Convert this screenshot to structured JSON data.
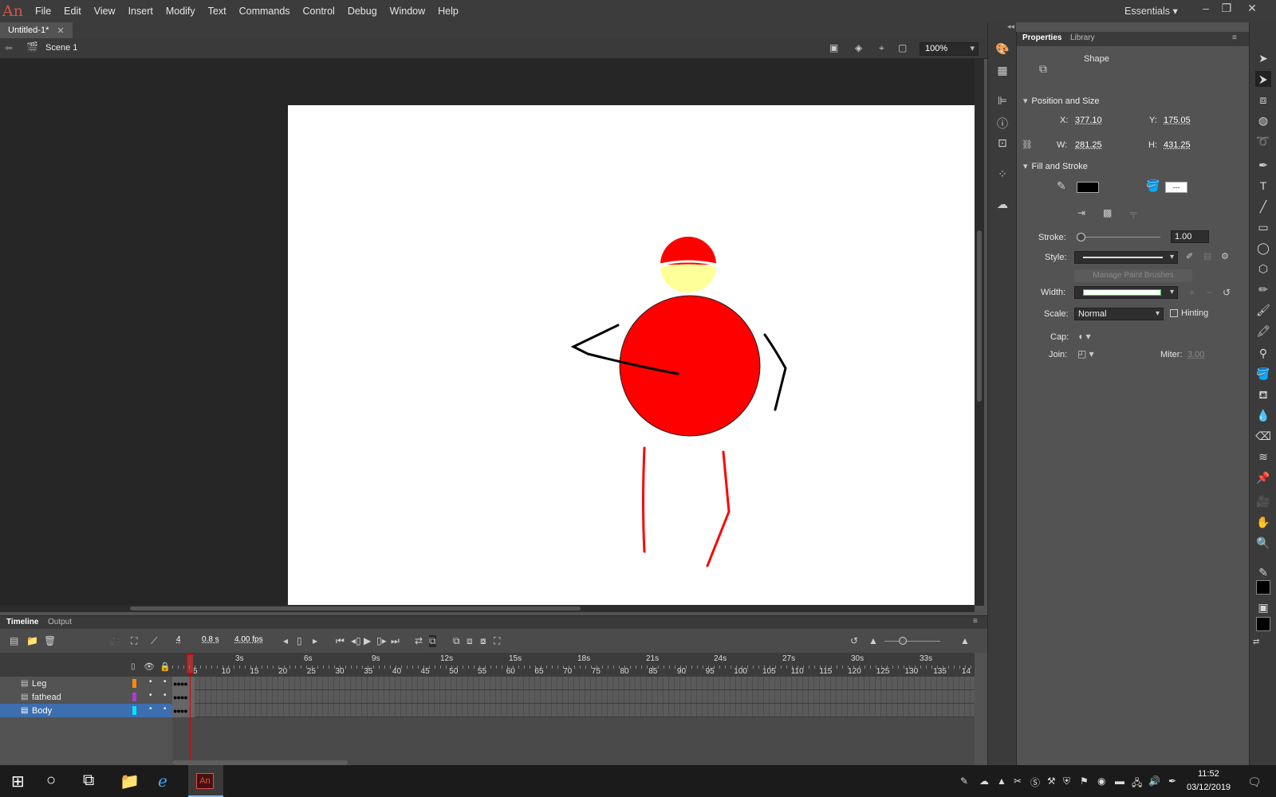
{
  "menubar": {
    "logo": "An",
    "items": [
      "File",
      "Edit",
      "View",
      "Insert",
      "Modify",
      "Text",
      "Commands",
      "Control",
      "Debug",
      "Window",
      "Help"
    ],
    "workspace": "Essentials"
  },
  "document": {
    "tab_title": "Untitled-1*",
    "scene": "Scene 1",
    "zoom": "100%"
  },
  "properties": {
    "tabs": [
      "Properties",
      "Library"
    ],
    "selection_type": "Shape",
    "position_and_size": {
      "heading": "Position and Size",
      "x_label": "X:",
      "x": "377.10",
      "y_label": "Y:",
      "y": "175.05",
      "w_label": "W:",
      "w": "281.25",
      "h_label": "H:",
      "h": "431.25"
    },
    "fill_and_stroke": {
      "heading": "Fill and Stroke",
      "stroke_color": "#000000",
      "stroke_label": "Stroke:",
      "stroke_value": "1.00",
      "style_label": "Style:",
      "manage_brushes": "Manage Paint Brushes",
      "width_label": "Width:",
      "scale_label": "Scale:",
      "scale_value": "Normal",
      "hinting_label": "Hinting",
      "cap_label": "Cap:",
      "join_label": "Join:",
      "miter_label": "Miter:",
      "miter_value": "3.00"
    }
  },
  "timeline": {
    "tabs": [
      "Timeline",
      "Output"
    ],
    "current_frame": "4",
    "elapsed": "0.8 s",
    "fps": "4.00 fps",
    "second_markers": [
      "3s",
      "6s",
      "9s",
      "12s",
      "15s",
      "18s",
      "21s",
      "24s",
      "27s",
      "30s",
      "33s"
    ],
    "frame_numbers": [
      "5",
      "10",
      "15",
      "20",
      "25",
      "30",
      "35",
      "40",
      "45",
      "50",
      "55",
      "60",
      "65",
      "70",
      "75",
      "80",
      "85",
      "90",
      "95",
      "100",
      "105",
      "110",
      "115",
      "120",
      "125",
      "130",
      "135",
      "14"
    ],
    "layers": [
      {
        "name": "Leg",
        "color": "#ff8c00",
        "selected": false
      },
      {
        "name": "fathead",
        "color": "#b03ad6",
        "selected": false
      },
      {
        "name": "Body",
        "color": "#00e5ff",
        "selected": true
      }
    ]
  },
  "taskbar": {
    "time": "11:52",
    "date": "03/12/2019"
  },
  "colors": {
    "accent_selected": "#3d6fb0",
    "stage_bg": "#ffffff",
    "body_red": "#ff0000",
    "face_yellow": "#ffff99"
  }
}
